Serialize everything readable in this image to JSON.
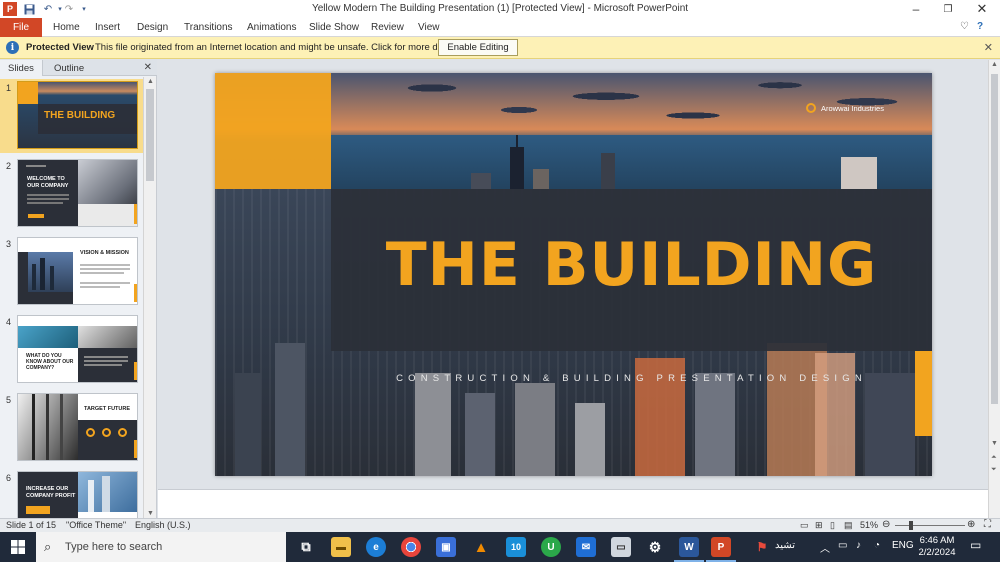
{
  "window": {
    "title": "Yellow Modern The Building Presentation (1) [Protected View] - Microsoft PowerPoint"
  },
  "ribbon": {
    "file": "File",
    "tabs": [
      "Home",
      "Insert",
      "Design",
      "Transitions",
      "Animations",
      "Slide Show",
      "Review",
      "View"
    ]
  },
  "protected": {
    "title": "Protected View",
    "message": "This file originated from an Internet location and might be unsafe. Click for more details.",
    "button": "Enable Editing"
  },
  "pane": {
    "tabs": {
      "slides": "Slides",
      "outline": "Outline"
    },
    "thumbs": [
      {
        "num": "1",
        "text": "THE BUILDING"
      },
      {
        "num": "2",
        "text": "WELCOME TO OUR COMPANY"
      },
      {
        "num": "3",
        "text": "VISION & MISSION"
      },
      {
        "num": "4",
        "text": "WHAT DO YOU KNOW ABOUT OUR COMPANY?"
      },
      {
        "num": "5",
        "text": "TARGET FUTURE"
      },
      {
        "num": "6",
        "text": "INCREASE OUR COMPANY PROFIT"
      }
    ]
  },
  "slide": {
    "company": "Arowwai Industries",
    "title": "THE BUILDING",
    "subtitle": "CONSTRUCTION & BUILDING PRESENTATION DESIGN",
    "accent": "#f2a41f",
    "dark": "#2b2f38"
  },
  "status": {
    "slide": "Slide 1 of 15",
    "theme": "\"Office Theme\"",
    "language": "English (U.S.)",
    "zoom": "51%"
  },
  "taskbar": {
    "search_placeholder": "Type here to search",
    "lang": "ENG",
    "time": "6:46 AM",
    "date": "2/2/2024",
    "badge": "10",
    "rtl_text": "تشيد"
  }
}
